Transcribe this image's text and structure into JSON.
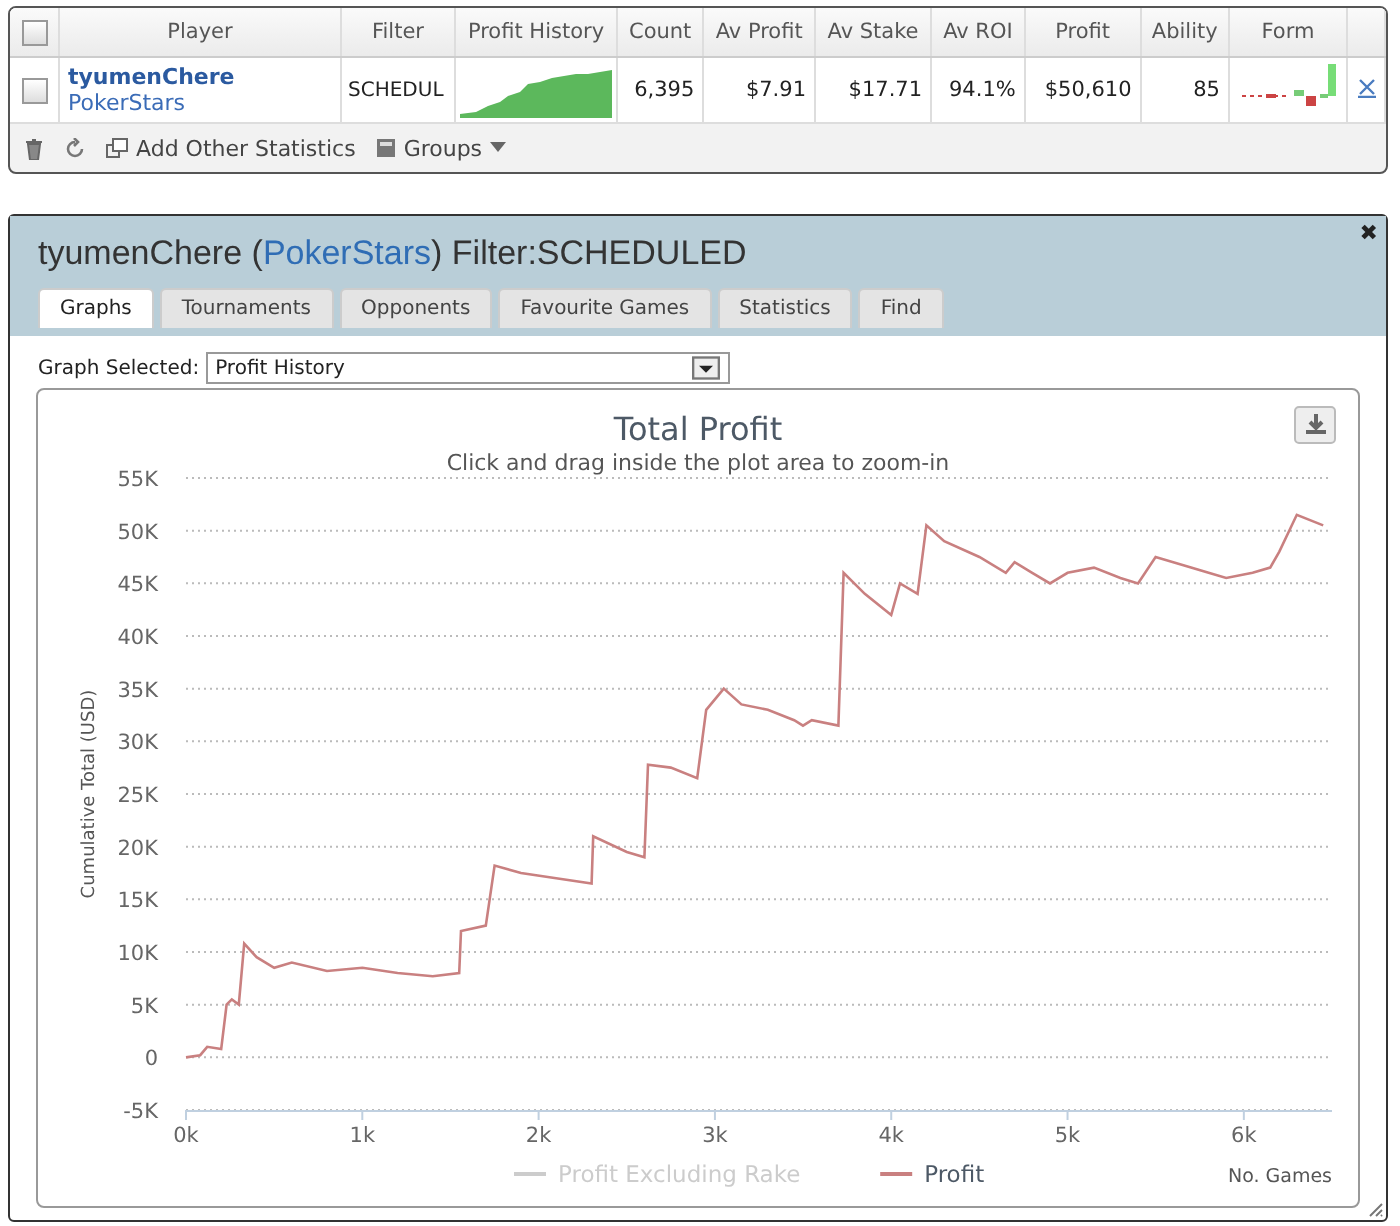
{
  "stats_table": {
    "columns": [
      "Player",
      "Filter",
      "Profit History",
      "Count",
      "Av Profit",
      "Av Stake",
      "Av ROI",
      "Profit",
      "Ability",
      "Form"
    ],
    "rows": [
      {
        "checked": false,
        "player": "tyumenChere",
        "site": "PokerStars",
        "filter": "SCHEDUL",
        "count": "6,395",
        "av_profit": "$7.91",
        "av_stake": "$17.71",
        "av_roi": "94.1%",
        "profit": "$50,610",
        "ability": "85"
      }
    ],
    "header_checked": false,
    "footer": [
      "Add Other Statistics",
      "Groups"
    ]
  },
  "detail_panel": {
    "title": [
      {
        "kind": "plain",
        "text": "tyumenChere ("
      },
      {
        "kind": "link",
        "text": "PokerStars"
      },
      {
        "kind": "plain",
        "text": ") Filter:SCHEDULED"
      }
    ],
    "close_glyph": "✖",
    "tabs": [
      {
        "label": "Graphs",
        "selected": true
      },
      {
        "label": "Tournaments",
        "selected": false
      },
      {
        "label": "Opponents",
        "selected": false
      },
      {
        "label": "Favourite Games",
        "selected": false
      },
      {
        "label": "Statistics",
        "selected": false
      },
      {
        "label": "Find",
        "selected": false
      }
    ],
    "graph_select": {
      "label": "Graph Selected:",
      "value": "Profit History"
    },
    "chart": {
      "subtitle": "Click and drag inside the plot area to zoom-in",
      "hidden_legend": [
        {
          "label": "Profit Excluding Rake",
          "visible": false
        }
      ],
      "chart_data": {
        "type": "line",
        "grid": true,
        "title": "Total Profit",
        "xlabel": "No. Games",
        "ylabel": "Cumulative Total (USD)",
        "x": [
          0,
          80,
          120,
          200,
          230,
          260,
          300,
          330,
          400,
          500,
          600,
          800,
          1000,
          1200,
          1400,
          1550,
          1560,
          1700,
          1750,
          1900,
          2100,
          2300,
          2310,
          2500,
          2600,
          2620,
          2750,
          2900,
          2950,
          3050,
          3150,
          3300,
          3450,
          3500,
          3550,
          3700,
          3730,
          3850,
          4000,
          4050,
          4150,
          4200,
          4300,
          4500,
          4650,
          4700,
          4800,
          4900,
          5000,
          5150,
          5300,
          5400,
          5500,
          5700,
          5800,
          5900,
          6050,
          6150,
          6200,
          6300,
          6450
        ],
        "series": [
          {
            "name": "Profit",
            "color": "#c98080",
            "values": [
              0,
              200,
              1000,
              800,
              5000,
              5500,
              5000,
              10800,
              9500,
              8500,
              9000,
              8200,
              8500,
              8000,
              7700,
              8000,
              12000,
              12500,
              18200,
              17500,
              17000,
              16500,
              21000,
              19500,
              19000,
              27800,
              27500,
              26500,
              33000,
              35000,
              33500,
              33000,
              32000,
              31500,
              32000,
              31500,
              46000,
              44000,
              42000,
              45000,
              44000,
              50500,
              49000,
              47500,
              46000,
              47000,
              46000,
              45000,
              46000,
              46500,
              45500,
              45000,
              47500,
              46500,
              46000,
              45500,
              46000,
              46500,
              48000,
              51500,
              50500
            ]
          }
        ],
        "xlim": [
          0,
          6500
        ],
        "ylim": [
          -5000,
          55000
        ],
        "xticks": [
          {
            "value": 0,
            "label": "0k"
          },
          {
            "value": 1000,
            "label": "1k"
          },
          {
            "value": 2000,
            "label": "2k"
          },
          {
            "value": 3000,
            "label": "3k"
          },
          {
            "value": 4000,
            "label": "4k"
          },
          {
            "value": 5000,
            "label": "5k"
          },
          {
            "value": 6000,
            "label": "6k"
          }
        ],
        "yticks": [
          {
            "value": -5000,
            "label": "-5K"
          },
          {
            "value": 0,
            "label": "0"
          },
          {
            "value": 5000,
            "label": "5K"
          },
          {
            "value": 10000,
            "label": "10K"
          },
          {
            "value": 15000,
            "label": "15K"
          },
          {
            "value": 20000,
            "label": "20K"
          },
          {
            "value": 25000,
            "label": "25K"
          },
          {
            "value": 30000,
            "label": "30K"
          },
          {
            "value": 35000,
            "label": "35K"
          },
          {
            "value": 40000,
            "label": "40K"
          },
          {
            "value": 45000,
            "label": "45K"
          },
          {
            "value": 50000,
            "label": "50K"
          },
          {
            "value": 55000,
            "label": "55K"
          }
        ]
      }
    }
  }
}
